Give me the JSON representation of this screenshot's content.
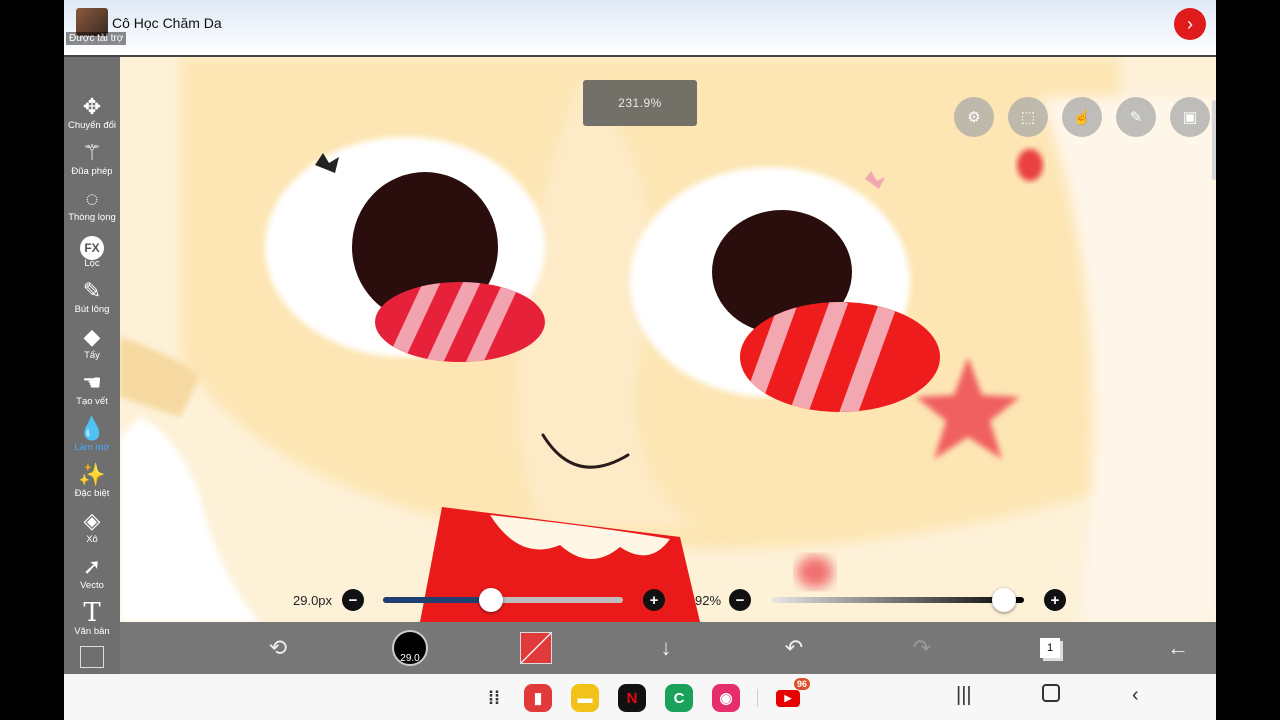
{
  "ad": {
    "title": "Cô Học Chăm Da",
    "sponsored": "Được tài trợ"
  },
  "canvas": {
    "zoom": "231.9%"
  },
  "tools": [
    {
      "label": "Chuyển đổi",
      "icon": "move-icon"
    },
    {
      "label": "Đũa phép",
      "icon": "magic-wand-icon"
    },
    {
      "label": "Thòng lọng",
      "icon": "lasso-icon"
    },
    {
      "label": "Lọc",
      "icon": "fx-icon"
    },
    {
      "label": "Bút lông",
      "icon": "brush-icon"
    },
    {
      "label": "Tẩy",
      "icon": "eraser-icon"
    },
    {
      "label": "Tạo vết",
      "icon": "smudge-icon"
    },
    {
      "label": "Làm mờ",
      "icon": "blur-drop-icon"
    },
    {
      "label": "Đặc biệt",
      "icon": "special-icon"
    },
    {
      "label": "Xô",
      "icon": "bucket-icon"
    },
    {
      "label": "Vecto",
      "icon": "vector-icon"
    },
    {
      "label": "Văn bản",
      "icon": "text-icon"
    }
  ],
  "brush": {
    "size_label": "29.0px",
    "size_fraction": 0.45,
    "opacity_label": "92%",
    "opacity_fraction": 0.92,
    "preview_text": "29.0"
  },
  "layers": {
    "count": "1"
  },
  "navbar": {
    "youtube_badge": "96"
  },
  "colors": {
    "accent": "#e01b1b",
    "primary_color": "#e03a3a",
    "sidebar": "#6f6f6f",
    "toolbar": "#5f5f5f"
  }
}
